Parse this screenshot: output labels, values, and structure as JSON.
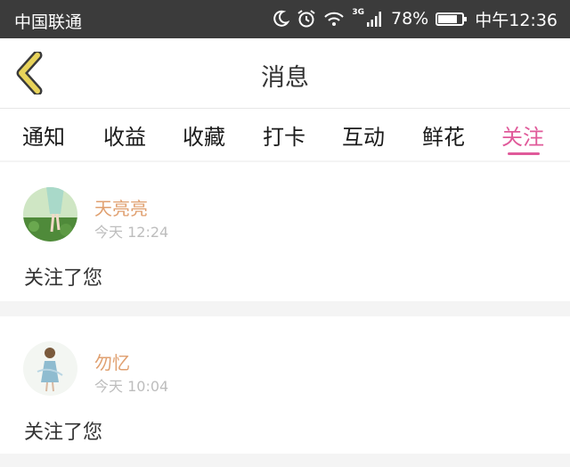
{
  "status_bar": {
    "carrier": "中国联通",
    "network": "3G",
    "battery_percent": "78%",
    "battery_level": 0.78,
    "time": "中午12:36",
    "icons": [
      "moon-icon",
      "alarm-icon",
      "wifi-icon",
      "signal-icon",
      "battery-icon"
    ]
  },
  "header": {
    "title": "消息",
    "back_icon": "chevron-left-icon"
  },
  "tabs": [
    {
      "label": "通知",
      "active": false
    },
    {
      "label": "收益",
      "active": false
    },
    {
      "label": "收藏",
      "active": false
    },
    {
      "label": "打卡",
      "active": false
    },
    {
      "label": "互动",
      "active": false
    },
    {
      "label": "鲜花",
      "active": false
    },
    {
      "label": "关注",
      "active": true
    }
  ],
  "messages": [
    {
      "username": "天亮亮",
      "time": "今天 12:24",
      "text": "关注了您"
    },
    {
      "username": "勿忆",
      "time": "今天 10:04",
      "text": "关注了您"
    }
  ],
  "colors": {
    "status_bar_bg": "#3b3b3b",
    "accent_pink": "#e05a9a",
    "username_orange": "#e0a070",
    "back_icon_yellow": "#e8d35a",
    "page_bg": "#f4f4f4"
  }
}
